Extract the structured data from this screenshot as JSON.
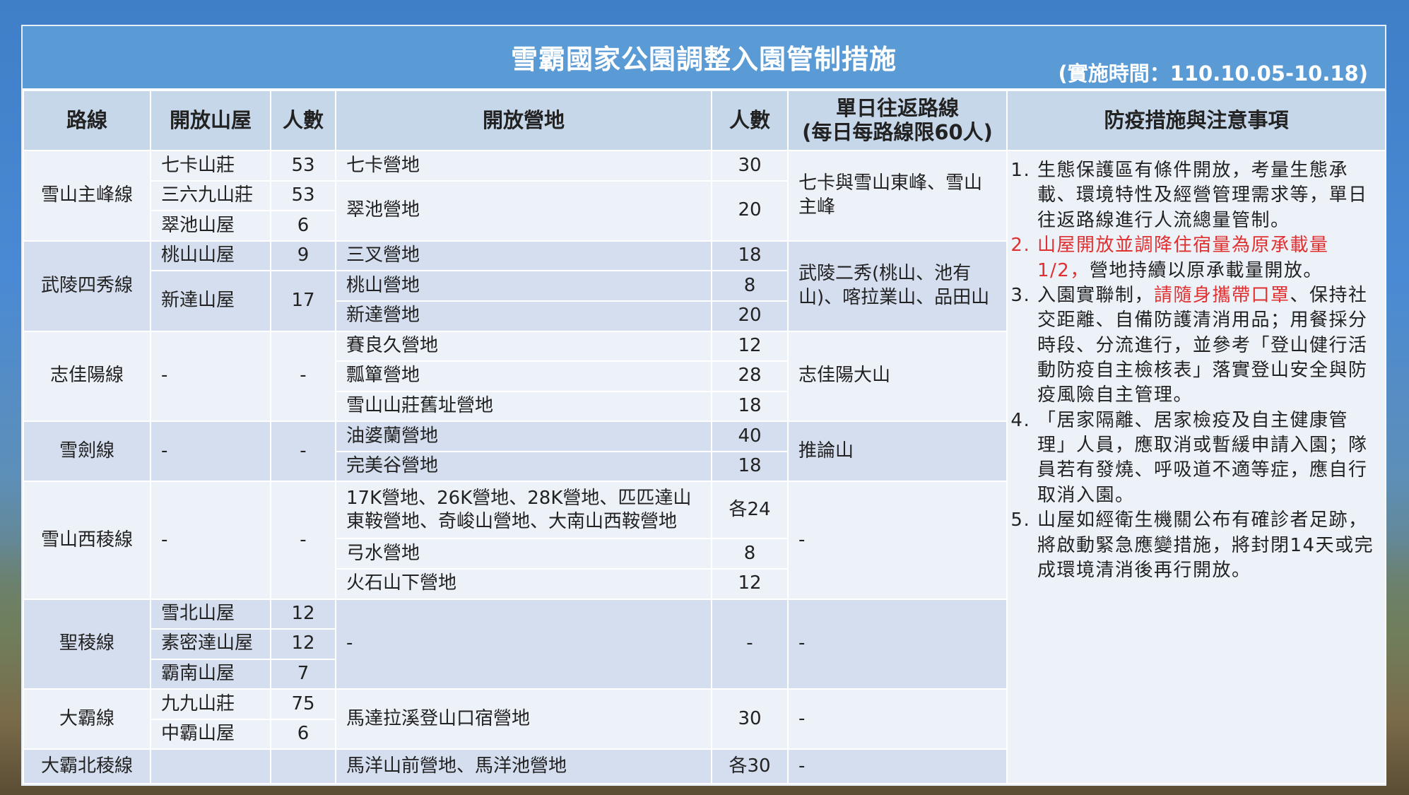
{
  "title": "雪霸國家公園調整入園管制措施",
  "period": "(實施時間：110.10.05-10.18)",
  "headers": {
    "route": "路線",
    "hut": "開放山屋",
    "hut_count": "人數",
    "camp": "開放營地",
    "camp_count": "人數",
    "day_line1": "單日往返路線",
    "day_line2": "(每日每路線限60人)",
    "notes": "防疫措施與注意事項"
  },
  "routes": [
    {
      "route": "雪山主峰線",
      "huts": [
        {
          "name": "七卡山莊",
          "count": "53"
        },
        {
          "name": "三六九山莊",
          "count": "53"
        },
        {
          "name": "翠池山屋",
          "count": "6"
        }
      ],
      "camps": [
        {
          "name": "七卡營地",
          "count": "30"
        },
        {
          "name": "翠池營地",
          "count": "20"
        }
      ],
      "day_trip": "七卡與雪山東峰、雪山主峰"
    },
    {
      "route": "武陵四秀線",
      "huts": [
        {
          "name": "桃山山屋",
          "count": "9"
        },
        {
          "name": "新達山屋",
          "count": "17"
        }
      ],
      "camps": [
        {
          "name": "三叉營地",
          "count": "18"
        },
        {
          "name": "桃山營地",
          "count": "8"
        },
        {
          "name": "新達營地",
          "count": "20"
        }
      ],
      "day_trip": "武陵二秀(桃山、池有山)、喀拉業山、品田山"
    },
    {
      "route": "志佳陽線",
      "hut": "-",
      "hut_count": "-",
      "camps": [
        {
          "name": "賽良久營地",
          "count": "12"
        },
        {
          "name": "瓢簞營地",
          "count": "28"
        },
        {
          "name": "雪山山莊舊址營地",
          "count": "18"
        }
      ],
      "day_trip": "志佳陽大山"
    },
    {
      "route": "雪劍線",
      "hut": "-",
      "hut_count": "-",
      "camps": [
        {
          "name": "油婆蘭營地",
          "count": "40"
        },
        {
          "name": "完美谷營地",
          "count": "18"
        }
      ],
      "day_trip": "推論山"
    },
    {
      "route": "雪山西稜線",
      "hut": "-",
      "hut_count": "-",
      "camps": [
        {
          "name": "17K營地、26K營地、28K營地、匹匹達山東鞍營地、奇峻山營地、大南山西鞍營地",
          "count": "各24"
        },
        {
          "name": "弓水營地",
          "count": "8"
        },
        {
          "name": "火石山下營地",
          "count": "12"
        }
      ],
      "day_trip": "-"
    },
    {
      "route": "聖稜線",
      "huts": [
        {
          "name": "雪北山屋",
          "count": "12"
        },
        {
          "name": "素密達山屋",
          "count": "12"
        },
        {
          "name": "霸南山屋",
          "count": "7"
        }
      ],
      "camp": "-",
      "camp_count": "-",
      "day_trip": "-"
    },
    {
      "route": "大霸線",
      "huts": [
        {
          "name": "九九山莊",
          "count": "75"
        },
        {
          "name": "中霸山屋",
          "count": "6"
        }
      ],
      "camp": "馬達拉溪登山口宿營地",
      "camp_count": "30",
      "day_trip": "-"
    },
    {
      "route": "大霸北稜線",
      "hut": "",
      "hut_count": "",
      "camp": "馬洋山前營地、馬洋池營地",
      "camp_count": "各30",
      "day_trip": "-"
    }
  ],
  "notes": [
    {
      "text": "生態保護區有條件開放，考量生態承載、環境特性及經營管理需求等，單日往返路線進行人流總量管制。"
    },
    {
      "text": "山屋開放並調降住宿量為原承載量1/2，",
      "text_after": "營地持續以原承載量開放。"
    },
    {
      "text": "入園實聯制，",
      "highlight": "請隨身攜帶口罩",
      "text_after": "、保持社交距離、自備防護清消用品；用餐採分時段、分流進行，並參考「登山健行活動防疫自主檢核表」落實登山安全與防疫風險自主管理。"
    },
    {
      "text": "「居家隔離、居家檢疫及自主健康管理」人員，應取消或暫緩申請入園；隊員若有發燒、呼吸道不適等症，應自行取消入園。"
    },
    {
      "text": "山屋如經衛生機關公布有確診者足跡，將啟動緊急應變措施，將封閉14天或完成環境清消後再行開放。"
    }
  ],
  "colors": {
    "title_bar": "#5b9bd5",
    "header_bg": "#c7d7ea",
    "row_light": "#edf1f8",
    "row_dark": "#d4deee",
    "highlight": "#e03030"
  }
}
